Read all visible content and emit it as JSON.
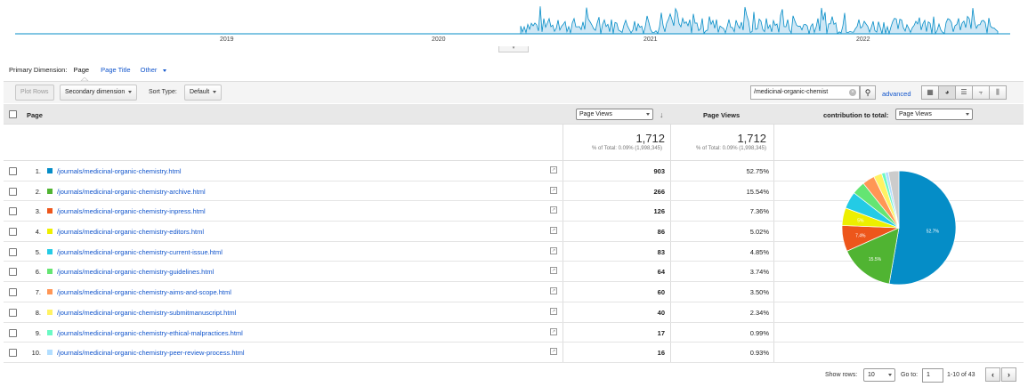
{
  "timeline": {
    "years": [
      "2019",
      "2020",
      "2021",
      "2022"
    ]
  },
  "primary_dimension": {
    "label": "Primary Dimension:",
    "options": [
      "Page",
      "Page Title",
      "Other"
    ]
  },
  "toolbar": {
    "plot_rows": "Plot Rows",
    "secondary_dimension": "Secondary dimension",
    "sort_type_label": "Sort Type:",
    "sort_type_value": "Default",
    "search_value": "/medicinal-organic-chemist",
    "advanced": "advanced",
    "view_icons": [
      "grid-view-icon",
      "pie-view-icon",
      "performance-view-icon",
      "comparison-view-icon",
      "pivot-view-icon"
    ]
  },
  "table": {
    "header": {
      "page": "Page",
      "metric_select": "Page Views",
      "metric_col": "Page Views",
      "contribution_label": "contribution to total:",
      "contribution_select": "Page Views"
    },
    "totals": {
      "value": "1,712",
      "sub": "% of Total: 0.09% (1,998,345)"
    },
    "rows": [
      {
        "rank": "1.",
        "page": "/journals/medicinal-organic-chemistry.html",
        "views": "903",
        "pct": "52.75%",
        "color": "#058dc7"
      },
      {
        "rank": "2.",
        "page": "/journals/medicinal-organic-chemistry-archive.html",
        "views": "266",
        "pct": "15.54%",
        "color": "#50b432"
      },
      {
        "rank": "3.",
        "page": "/journals/medicinal-organic-chemistry-inpress.html",
        "views": "126",
        "pct": "7.36%",
        "color": "#ed561b"
      },
      {
        "rank": "4.",
        "page": "/journals/medicinal-organic-chemistry-editors.html",
        "views": "86",
        "pct": "5.02%",
        "color": "#edef00"
      },
      {
        "rank": "5.",
        "page": "/journals/medicinal-organic-chemistry-current-issue.html",
        "views": "83",
        "pct": "4.85%",
        "color": "#24cbe5"
      },
      {
        "rank": "6.",
        "page": "/journals/medicinal-organic-chemistry-guidelines.html",
        "views": "64",
        "pct": "3.74%",
        "color": "#64e572"
      },
      {
        "rank": "7.",
        "page": "/journals/medicinal-organic-chemistry-aims-and-scope.html",
        "views": "60",
        "pct": "3.50%",
        "color": "#ff9655"
      },
      {
        "rank": "8.",
        "page": "/journals/medicinal-organic-chemistry-submitmanuscript.html",
        "views": "40",
        "pct": "2.34%",
        "color": "#fff263"
      },
      {
        "rank": "9.",
        "page": "/journals/medicinal-organic-chemistry-ethical-malpractices.html",
        "views": "17",
        "pct": "0.99%",
        "color": "#6af9c4"
      },
      {
        "rank": "10.",
        "page": "/journals/medicinal-organic-chemistry-peer-review-process.html",
        "views": "16",
        "pct": "0.93%",
        "color": "#b2deff"
      }
    ]
  },
  "pie": {
    "slices": [
      52.75,
      15.54,
      7.36,
      5.02,
      4.85,
      3.74,
      3.5,
      2.34,
      0.99,
      0.93,
      3.0
    ],
    "colors": [
      "#058dc7",
      "#50b432",
      "#ed561b",
      "#edef00",
      "#24cbe5",
      "#64e572",
      "#ff9655",
      "#fff263",
      "#6af9c4",
      "#b2deff",
      "#cccccc"
    ],
    "labels": [
      "52.7%",
      "15.5%",
      "7.4%",
      "5%"
    ]
  },
  "footer": {
    "show_rows_label": "Show rows:",
    "show_rows_value": "10",
    "goto_label": "Go to:",
    "goto_value": "1",
    "range": "1-10 of 43"
  }
}
